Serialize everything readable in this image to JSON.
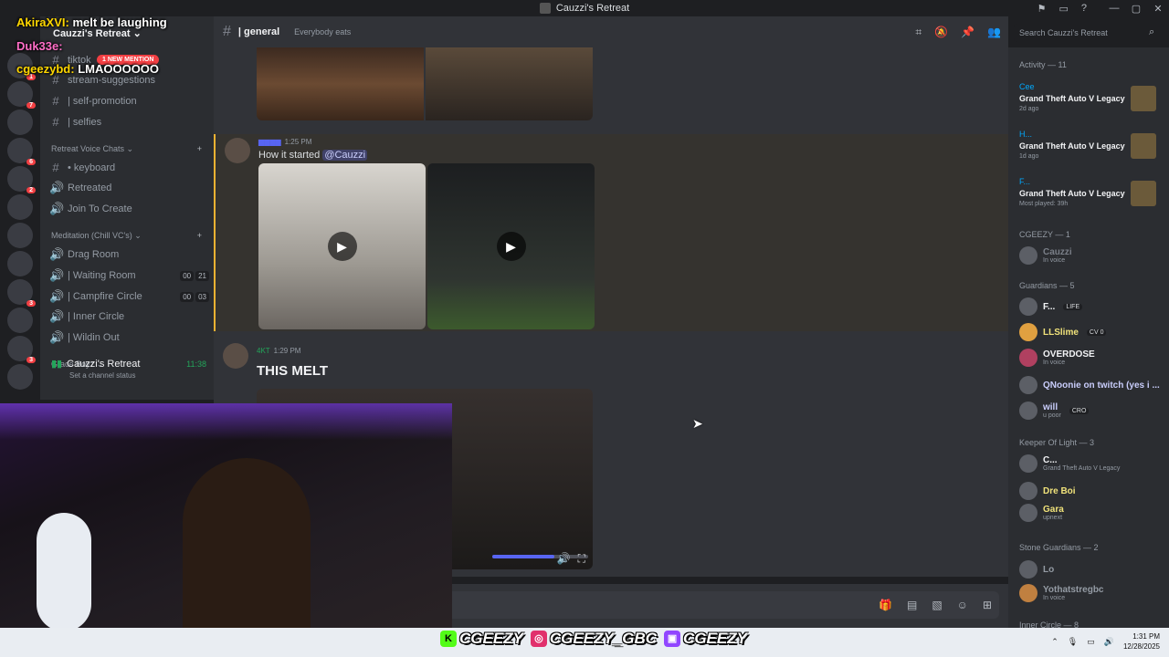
{
  "window": {
    "title": "Cauzzi's Retreat",
    "controls": [
      "—",
      "▢",
      "✕"
    ]
  },
  "server": {
    "name": "Cauzzi's Retreat",
    "new_mention": "1 NEW MENTION",
    "channels_top": [
      {
        "label": "tiktok"
      },
      {
        "label": "stream-suggestions"
      },
      {
        "label": "| self-promotion"
      },
      {
        "label": "| selfies"
      }
    ],
    "category_voice": "Retreat Voice Chats",
    "voice_channels": [
      {
        "label": "• keyboard"
      },
      {
        "label": "Retreated"
      },
      {
        "label": "Join To Create"
      }
    ],
    "category_meditation": "Meditation (Chill VC's)",
    "meditation_channels": [
      {
        "label": "Drag Room",
        "count": ""
      },
      {
        "label": "| Waiting Room",
        "count_a": "00",
        "count_b": "21"
      },
      {
        "label": "| Campfire Circle",
        "count_a": "00",
        "count_b": "03"
      },
      {
        "label": "| Inner Circle",
        "count": ""
      },
      {
        "label": "| Wildin Out",
        "count": ""
      }
    ],
    "category_grace": "Grace Boyz",
    "voice_user": {
      "name": "Cauzzi's Retreat",
      "time": "11:38",
      "status": "Set a channel status"
    },
    "guild_badges": [
      "1",
      "7",
      "6",
      "2",
      "3",
      "3"
    ]
  },
  "channel": {
    "name": "| general",
    "topic": "Everybody eats"
  },
  "search": {
    "placeholder": "Search Cauzzi's Retreat"
  },
  "messages": [
    {
      "time": "1:25 PM",
      "text": "How it started",
      "mention": "@Cauzzi"
    },
    {
      "author": "4KT",
      "time": "1:29 PM",
      "text": "THIS MELT",
      "progress": 0.65
    }
  ],
  "members": {
    "activity_header": "Activity — 11",
    "activities": [
      {
        "who": "Cee",
        "game": "Grand Theft Auto V Legacy",
        "when": "2d ago"
      },
      {
        "who": "H...",
        "game": "Grand Theft Auto V Legacy",
        "when": "1d ago"
      },
      {
        "who": "F...",
        "game": "Grand Theft Auto V Legacy",
        "when": "Most played: 39h"
      }
    ],
    "groups": [
      {
        "header": "CGEEZY — 1",
        "members": [
          {
            "name": "Cauzzi",
            "sub": "In voice"
          }
        ]
      },
      {
        "header": "Guardians — 5",
        "members": [
          {
            "name": "F...",
            "tag": "LIFE",
            "sub": ""
          },
          {
            "name": "LLSlime",
            "tag": "CV 0",
            "sub": ""
          },
          {
            "name": "OVERDOSE",
            "sub": "In voice"
          },
          {
            "name": "QNoonie on twitch (yes i ...",
            "sub": ""
          },
          {
            "name": "will",
            "tag": "CRO",
            "sub": "u poor"
          }
        ]
      },
      {
        "header": "Keeper Of Light — 3",
        "members": [
          {
            "name": "C...",
            "sub": "Grand Theft Auto V Legacy"
          },
          {
            "name": "Dre Boi",
            "sub": ""
          },
          {
            "name": "Gara",
            "sub": "upnext"
          }
        ]
      },
      {
        "header": "Stone Guardians — 2",
        "members": [
          {
            "name": "Lo",
            "sub": ""
          },
          {
            "name": "Yothatstregbc",
            "sub": "In voice"
          }
        ]
      },
      {
        "header": "Inner Circle — 8",
        "members": []
      }
    ]
  },
  "overlay_chat": [
    {
      "user": "AkiraXVI:",
      "msg": "melt be laughing"
    },
    {
      "user": "Duk33e:",
      "msg": ""
    },
    {
      "user": "cgeezybd:",
      "msg": "LMAOOOOOO"
    }
  ],
  "socials": [
    {
      "icon": "K",
      "handle": "CGEEZY",
      "color": "#53fc18"
    },
    {
      "icon": "◎",
      "handle": "CGEEZY_GBC",
      "color": "#e1306c"
    },
    {
      "icon": "▣",
      "handle": "CGEEZY",
      "color": "#9146ff"
    }
  ],
  "taskbar": {
    "time": "1:31 PM",
    "date": "12/28/2025"
  }
}
